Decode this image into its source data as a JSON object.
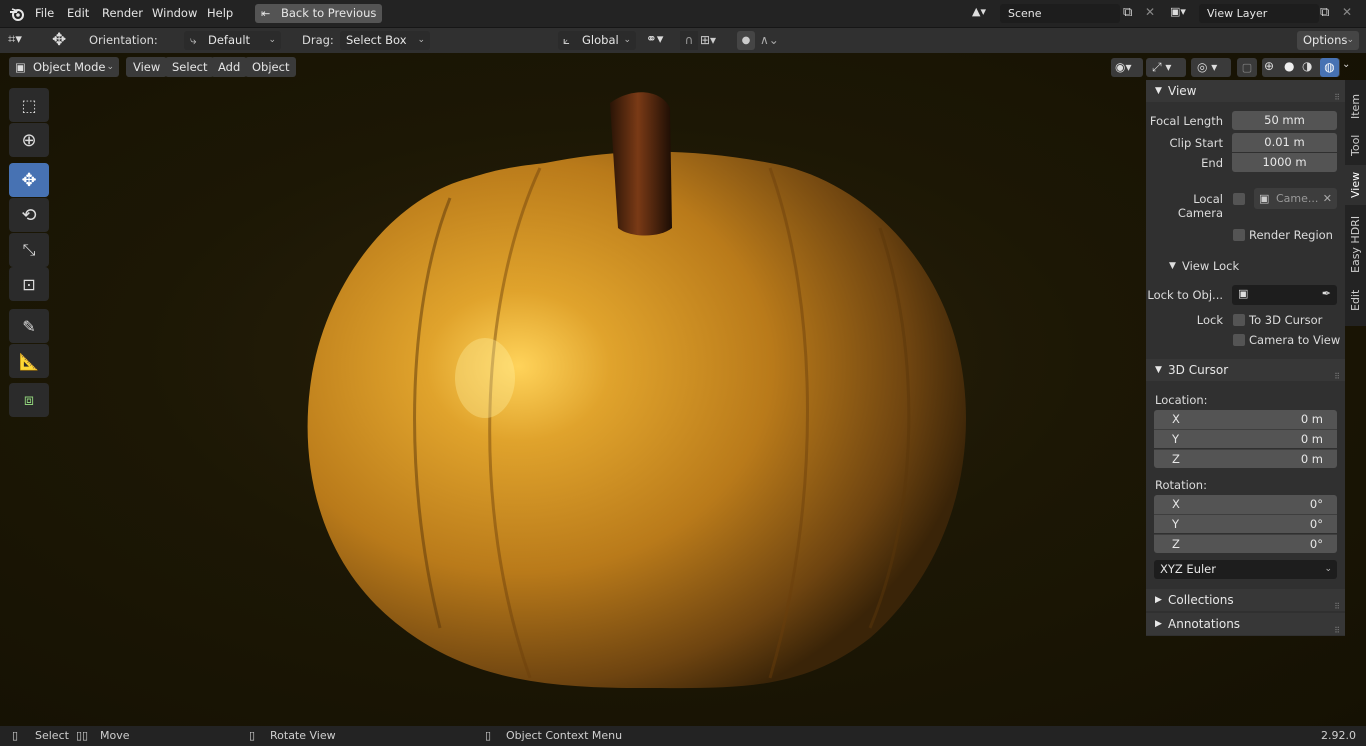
{
  "topbar": {
    "menus": [
      "File",
      "Edit",
      "Render",
      "Window",
      "Help"
    ],
    "back_button": "Back to Previous",
    "scene": "Scene",
    "view_layer": "View Layer"
  },
  "toolbar": {
    "orientation_label": "Orientation:",
    "orientation_value": "Default",
    "drag_label": "Drag:",
    "drag_value": "Select Box",
    "transform_orientation": "Global",
    "options_label": "Options"
  },
  "viewport_header": {
    "mode": "Object Mode",
    "menus": [
      "View",
      "Select",
      "Add",
      "Object"
    ]
  },
  "npanel": {
    "view_title": "View",
    "focal_length_label": "Focal Length",
    "focal_length_value": "50 mm",
    "clip_start_label": "Clip Start",
    "clip_start_value": "0.01 m",
    "clip_end_label": "End",
    "clip_end_value": "1000 m",
    "local_camera_label": "Local Camera",
    "local_camera_value": "Came...",
    "render_region_label": "Render Region",
    "view_lock_title": "View Lock",
    "lock_to_object_label": "Lock to Obj...",
    "lock_label": "Lock",
    "to_3d_cursor_label": "To 3D Cursor",
    "camera_to_view_label": "Camera to View",
    "cursor_title": "3D Cursor",
    "location_label": "Location:",
    "location": [
      {
        "axis": "X",
        "value": "0 m"
      },
      {
        "axis": "Y",
        "value": "0 m"
      },
      {
        "axis": "Z",
        "value": "0 m"
      }
    ],
    "rotation_label": "Rotation:",
    "rotation": [
      {
        "axis": "X",
        "value": "0°"
      },
      {
        "axis": "Y",
        "value": "0°"
      },
      {
        "axis": "Z",
        "value": "0°"
      }
    ],
    "rotation_mode": "XYZ Euler",
    "collections_title": "Collections",
    "annotations_title": "Annotations"
  },
  "side_tabs": [
    "Item",
    "Tool",
    "View",
    "Easy HDRI",
    "Edit"
  ],
  "statusbar": {
    "select": "Select",
    "move": "Move",
    "rotate_view": "Rotate View",
    "context_menu": "Object Context Menu",
    "version": "2.92.0"
  },
  "colors": {
    "accent": "#4772b3",
    "pumpkin": "#c98a1e",
    "background": "#1a1504"
  }
}
